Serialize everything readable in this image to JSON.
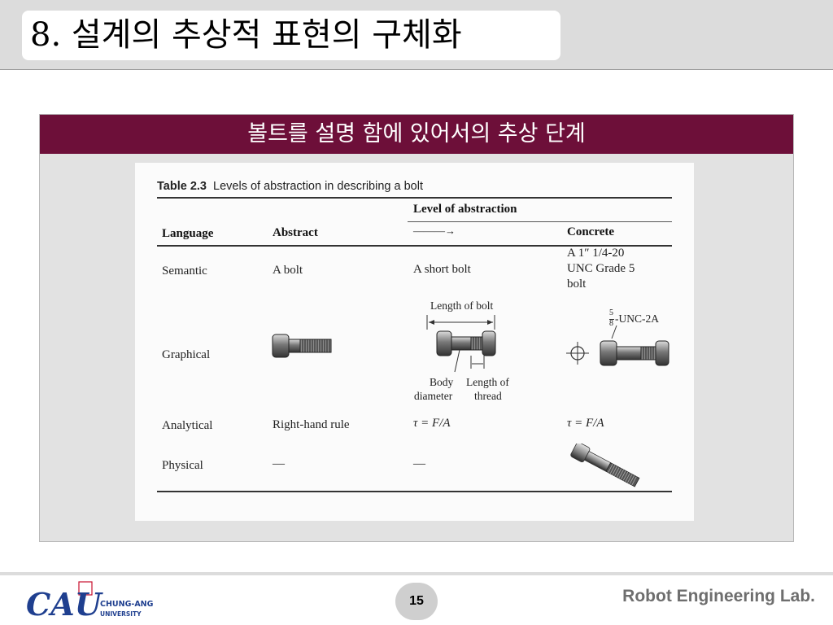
{
  "slide": {
    "title": "8. 설계의 추상적 표현의 구체화",
    "subtitle": "볼트를 설명 함에 있어서의 추상 단계"
  },
  "table": {
    "caption_label": "Table 2.3",
    "caption_text": "Levels of abstraction in describing a bolt",
    "group_header": "Level of abstraction",
    "arrow": "———→",
    "columns": [
      "Language",
      "Abstract",
      "Concrete"
    ],
    "rows": {
      "semantic": {
        "label": "Semantic",
        "abstract": "A bolt",
        "middle": "A short bolt",
        "concrete_lines": [
          "A 1″ 1/4-20",
          "UNC Grade 5",
          "bolt"
        ]
      },
      "graphical": {
        "label": "Graphical",
        "length_of_bolt": "Length of bolt",
        "body_diameter_lines": [
          "Body",
          "diameter"
        ],
        "length_of_thread_lines": [
          "Length of",
          "thread"
        ],
        "unc_fraction_num": "5",
        "unc_fraction_den": "8",
        "unc_text": "-UNC-2A"
      },
      "analytical": {
        "label": "Analytical",
        "abstract": "Right-hand rule",
        "middle": "τ = F/A",
        "concrete": "τ = F/A"
      },
      "physical": {
        "label": "Physical",
        "abstract": "—",
        "middle": "—"
      }
    }
  },
  "footer": {
    "logo_text": "CAU",
    "logo_sub_1": "CHUNG-ANG",
    "logo_sub_2": "UNIVERSITY",
    "page_number": "15",
    "lab_name": "Robot Engineering Lab."
  },
  "colors": {
    "panel_header_bg": "#6d0f39",
    "logo_blue": "#1f3f8f",
    "logo_red": "#c8102e"
  }
}
